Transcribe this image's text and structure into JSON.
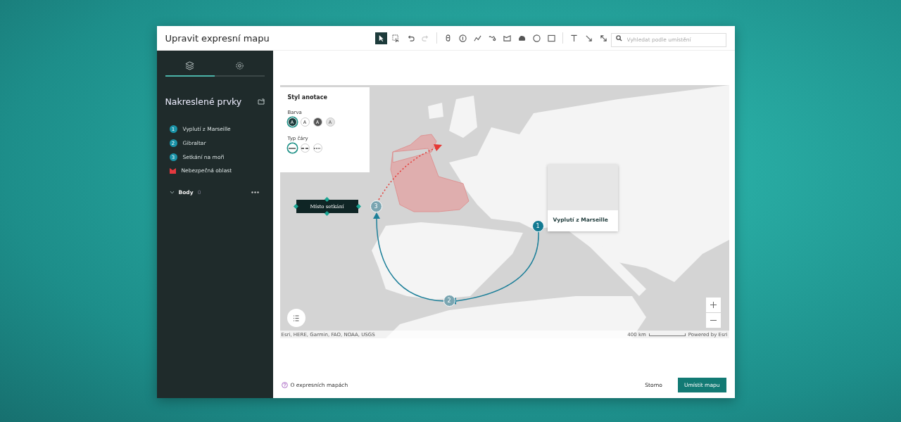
{
  "window": {
    "title": "Upravit expresní mapu"
  },
  "toolbar": {
    "tools": [
      {
        "kind": "select",
        "selected": true,
        "disabled": false
      },
      {
        "kind": "lasso",
        "selected": false,
        "disabled": false
      },
      {
        "kind": "undo",
        "selected": false,
        "disabled": false
      },
      {
        "kind": "redo",
        "selected": false,
        "disabled": true
      },
      {
        "kind": "pin",
        "selected": false,
        "disabled": false
      },
      {
        "kind": "numbered",
        "selected": false,
        "disabled": false
      },
      {
        "kind": "line",
        "selected": false,
        "disabled": false
      },
      {
        "kind": "freehand",
        "selected": false,
        "disabled": false
      },
      {
        "kind": "polygon",
        "selected": false,
        "disabled": false
      },
      {
        "kind": "blob",
        "selected": false,
        "disabled": false
      },
      {
        "kind": "circle",
        "selected": false,
        "disabled": false
      },
      {
        "kind": "rectangle",
        "selected": false,
        "disabled": false
      },
      {
        "kind": "text",
        "selected": false,
        "disabled": false
      },
      {
        "kind": "arrow",
        "selected": false,
        "disabled": false
      },
      {
        "kind": "double-arrow",
        "selected": false,
        "disabled": false
      }
    ]
  },
  "search": {
    "placeholder": "Vyhledat podle umístění"
  },
  "sidebar": {
    "tabs": [
      {
        "kind": "layers",
        "selected": true
      },
      {
        "kind": "settings",
        "selected": false
      }
    ],
    "title": "Nakreslené prvky",
    "items": [
      {
        "kind": "point",
        "number": "1",
        "label": "Vyplutí z Marseille"
      },
      {
        "kind": "point",
        "number": "2",
        "label": "Gibraltar"
      },
      {
        "kind": "point",
        "number": "3",
        "label": "Setkání na moři"
      },
      {
        "kind": "area",
        "label": "Nebezpečná oblast"
      }
    ],
    "group": {
      "label": "Body",
      "count": "0",
      "expanded": true
    }
  },
  "style_panel": {
    "title": "Styl anotace",
    "color_label": "Barva",
    "colors": [
      {
        "glyph": "A",
        "selected": true
      },
      {
        "glyph": "A",
        "selected": false
      },
      {
        "glyph": "A",
        "selected": false
      },
      {
        "glyph": "A",
        "selected": false
      }
    ],
    "line_label": "Typ čáry",
    "line_types": [
      {
        "kind": "solid",
        "selected": true
      },
      {
        "kind": "dashed",
        "selected": false
      },
      {
        "kind": "dotted",
        "selected": false
      }
    ]
  },
  "map": {
    "callout": "Místo setkání",
    "markers": [
      {
        "number": "1"
      },
      {
        "number": "2"
      },
      {
        "number": "3"
      }
    ],
    "popup": {
      "title": "Vyplutí z Marseille"
    },
    "attribution": "Esri, HERE, Garmin, FAO, NOAA, USGS",
    "scale": "400 km",
    "powered_by": "Powered by Esri"
  },
  "footer": {
    "help_link": "O expresních mapách",
    "cancel": "Storno",
    "submit": "Umístit mapu"
  }
}
